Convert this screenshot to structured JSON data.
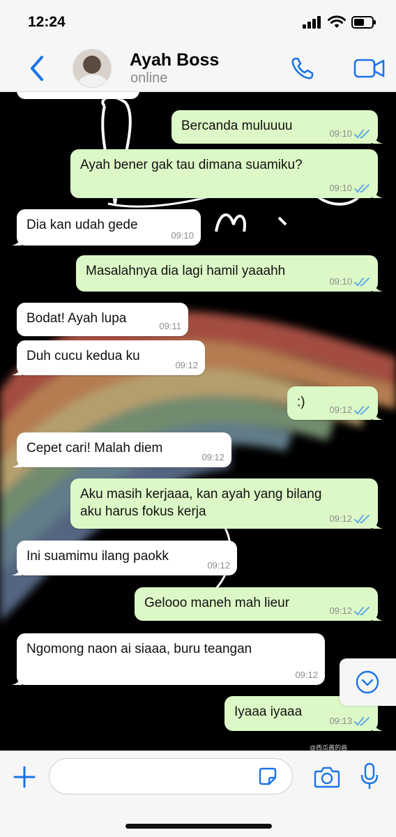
{
  "status_bar": {
    "time": "12:24"
  },
  "header": {
    "contact_name": "Ayah Boss",
    "contact_status": "online"
  },
  "messages": [
    {
      "dir": "out",
      "text": "Bercanda muluuuu",
      "time": "09:10"
    },
    {
      "dir": "out",
      "text": "Ayah bener gak tau dimana suamiku?",
      "time": "09:10"
    },
    {
      "dir": "in",
      "text": "Dia kan udah gede",
      "time": "09:10"
    },
    {
      "dir": "out",
      "text": "Masalahnya dia lagi hamil yaaahh",
      "time": "09:10"
    },
    {
      "dir": "in",
      "text": "Bodat! Ayah lupa",
      "time": "09:11"
    },
    {
      "dir": "in",
      "text": "Duh cucu kedua ku",
      "time": "09:12"
    },
    {
      "dir": "out",
      "text": ":)",
      "time": "09:12"
    },
    {
      "dir": "in",
      "text": "Cepet cari! Malah diem",
      "time": "09:12"
    },
    {
      "dir": "out",
      "text": "Aku masih kerjaaa, kan ayah yang bilang\naku harus fokus kerja",
      "time": "09:12"
    },
    {
      "dir": "in",
      "text": "Ini suamimu ilang paokk",
      "time": "09:12"
    },
    {
      "dir": "out",
      "text": "Gelooo maneh mah lieur",
      "time": "09:12"
    },
    {
      "dir": "in",
      "text": "Ngomong naon ai siaaa, buru teangan",
      "time": "09:12"
    },
    {
      "dir": "out",
      "text": "Iyaaa iyaaa",
      "time": "09:13"
    }
  ],
  "watermark": "@西瓜酱的画",
  "composer": {
    "placeholder": "",
    "value": ""
  },
  "colors": {
    "accent": "#1a73e8",
    "outgoing_bubble": "#dcf8c6",
    "incoming_bubble": "#ffffff",
    "read_ticks": "#4fa3e6"
  },
  "icons": {
    "back": "chevron-left-icon",
    "call": "phone-icon",
    "video": "video-camera-icon",
    "attach": "plus-icon",
    "sticker": "sticker-icon",
    "camera": "camera-icon",
    "mic": "microphone-icon",
    "scroll": "chevron-down-circle-icon",
    "read": "double-check-icon"
  }
}
